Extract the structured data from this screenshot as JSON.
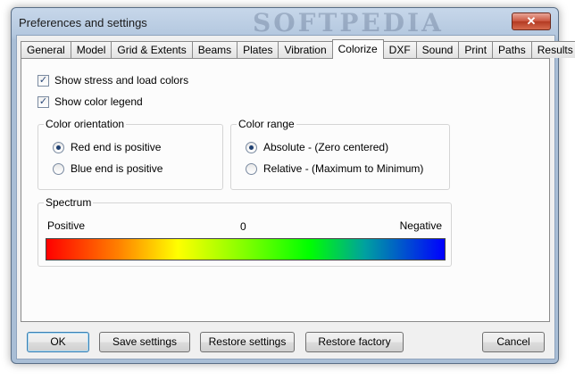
{
  "window": {
    "title": "Preferences and settings",
    "watermark": "SOFTPEDIA",
    "close_symbol": "✕"
  },
  "tabs": [
    "General",
    "Model",
    "Grid & Extents",
    "Beams",
    "Plates",
    "Vibration",
    "Colorize",
    "DXF",
    "Sound",
    "Print",
    "Paths",
    "Results"
  ],
  "active_tab": "Colorize",
  "colorize": {
    "show_stress_label": "Show stress and load colors",
    "show_stress_checked": true,
    "show_legend_label": "Show color legend",
    "show_legend_checked": true,
    "check_mark": "✓",
    "orientation": {
      "title": "Color orientation",
      "options": [
        "Red end is positive",
        "Blue end is positive"
      ],
      "selected": 0
    },
    "range": {
      "title": "Color range",
      "options": [
        "Absolute - (Zero centered)",
        "Relative - (Maximum to Minimum)"
      ],
      "selected": 0
    },
    "spectrum": {
      "title": "Spectrum",
      "left_label": "Positive",
      "center_label": "0",
      "right_label": "Negative",
      "colors": [
        "#ff0000",
        "#ff8000",
        "#ffff00",
        "#80ff00",
        "#00ff00",
        "#00a0a0",
        "#0000ff"
      ]
    }
  },
  "buttons": {
    "ok": "OK",
    "save": "Save settings",
    "restore": "Restore settings",
    "factory": "Restore factory",
    "cancel": "Cancel"
  }
}
